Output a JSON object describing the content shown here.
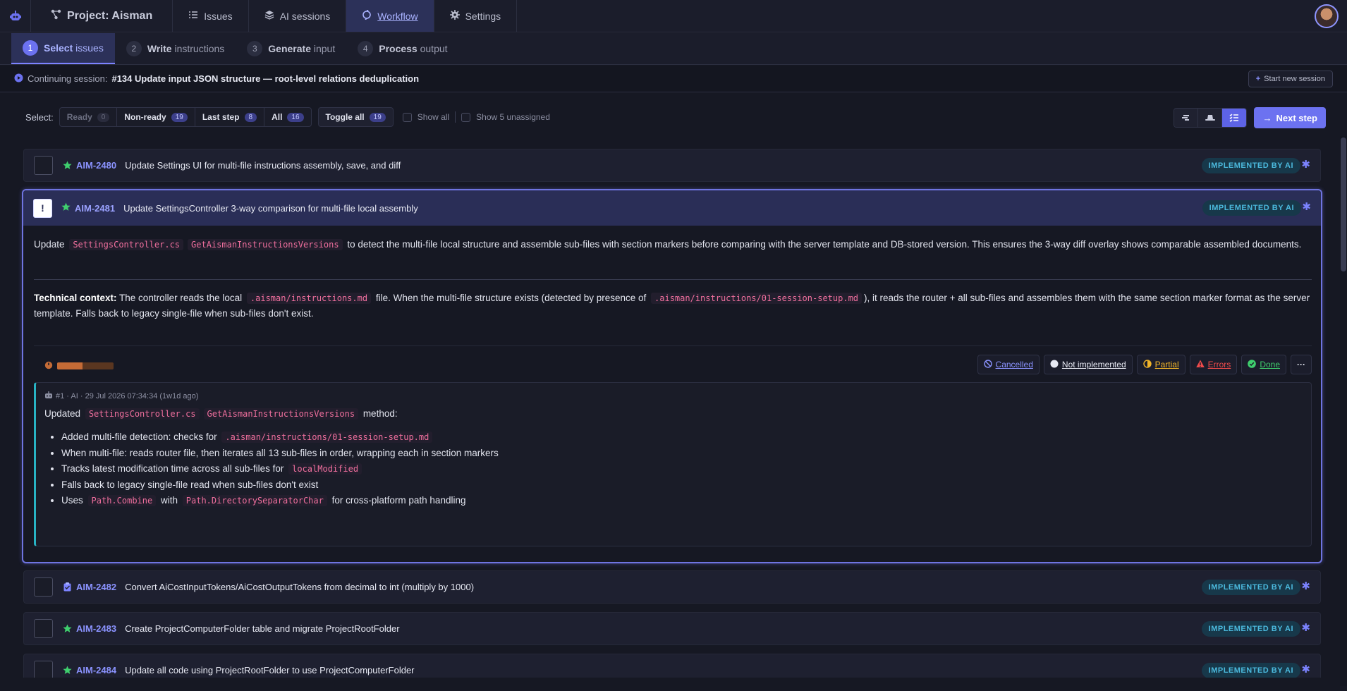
{
  "nav": {
    "project": "Project: Aisman",
    "items": [
      {
        "label": "Issues"
      },
      {
        "label": "AI sessions"
      },
      {
        "label": "Workflow"
      },
      {
        "label": "Settings"
      }
    ]
  },
  "steps": [
    {
      "num": "1",
      "bold": "Select",
      "rest": "issues"
    },
    {
      "num": "2",
      "bold": "Write",
      "rest": "instructions"
    },
    {
      "num": "3",
      "bold": "Generate",
      "rest": "input"
    },
    {
      "num": "4",
      "bold": "Process",
      "rest": "output"
    }
  ],
  "session": {
    "prefix": "Continuing session:",
    "title": "#134 Update input JSON structure — root-level relations deduplication",
    "new_button": "Start new session"
  },
  "filters": {
    "label": "Select:",
    "segments": [
      {
        "label": "Ready",
        "count": "0"
      },
      {
        "label": "Non-ready",
        "count": "19"
      },
      {
        "label": "Last step",
        "count": "8"
      },
      {
        "label": "All",
        "count": "16"
      }
    ],
    "toggle_all": {
      "label": "Toggle all",
      "count": "19"
    },
    "show_all": "Show all",
    "show_unassigned": "Show 5 unassigned",
    "next_step": "Next step"
  },
  "issues": [
    {
      "key": "AIM-2480",
      "title": "Update Settings UI for multi-file instructions assembly, save, and diff",
      "status": "IMPLEMENTED BY AI",
      "icon": "star-icon"
    },
    {
      "key": "AIM-2481",
      "title": "Update SettingsController 3-way comparison for multi-file local assembly",
      "status": "IMPLEMENTED BY AI",
      "icon": "star-icon"
    },
    {
      "key": "AIM-2482",
      "title": "Convert AiCostInputTokens/AiCostOutputTokens from decimal to int (multiply by 1000)",
      "status": "IMPLEMENTED BY AI",
      "icon": "clipboard-icon"
    },
    {
      "key": "AIM-2483",
      "title": "Create ProjectComputerFolder table and migrate ProjectRootFolder",
      "status": "IMPLEMENTED BY AI",
      "icon": "star-icon"
    },
    {
      "key": "AIM-2484",
      "title": "Update all code using ProjectRootFolder to use ProjectComputerFolder",
      "status": "IMPLEMENTED BY AI",
      "icon": "star-icon"
    }
  ],
  "expanded": {
    "checkbox_mark": "!",
    "desc_pre": "Update",
    "desc_code1": "SettingsController.cs",
    "desc_code2": "GetAismanInstructionsVersions",
    "desc_post": "to detect the multi-file local structure and assemble sub-files with section markers before comparing with the server template and DB-stored version. This ensures the 3-way diff overlay shows comparable assembled documents.",
    "tech_label": "Technical context:",
    "tech_pre": "The controller reads the local",
    "tech_code1": ".aisman/instructions.md",
    "tech_mid": "file. When the multi-file structure exists (detected by presence of",
    "tech_code2": ".aisman/instructions/01-session-setup.md",
    "tech_post": "), it reads the router + all sub-files and assembles them with the same section marker format as the server template. Falls back to legacy single-file when sub-files don't exist.",
    "progress": 0.45,
    "status_buttons": [
      {
        "label": "Cancelled",
        "color": "#8b93ff",
        "icon": "cancel-icon"
      },
      {
        "label": "Not implemented",
        "color": "#e7e9f3",
        "icon": "circle-icon"
      },
      {
        "label": "Partial",
        "color": "#f0b429",
        "icon": "half-circle-icon"
      },
      {
        "label": "Errors",
        "color": "#ef4b4b",
        "icon": "warning-icon"
      },
      {
        "label": "Done",
        "color": "#3fcf6e",
        "icon": "check-icon"
      }
    ],
    "comment": {
      "meta": "#1 · AI · 29 Jul 2026 07:34:34 (1w1d ago)",
      "body_pre": "Updated",
      "body_code1": "SettingsController.cs",
      "body_code2": "GetAismanInstructionsVersions",
      "body_post": "method:",
      "items": [
        {
          "pre": "Added multi-file detection: checks for",
          "code": ".aisman/instructions/01-session-setup.md",
          "mid": "",
          "code2": "",
          "post": ""
        },
        {
          "pre": "When multi-file: reads router file, then iterates all 13 sub-files in order, wrapping each in section markers",
          "code": "",
          "mid": "",
          "code2": "",
          "post": ""
        },
        {
          "pre": "Tracks latest modification time across all sub-files for",
          "code": "localModified",
          "mid": "",
          "code2": "",
          "post": ""
        },
        {
          "pre": "Falls back to legacy single-file read when sub-files don't exist",
          "code": "",
          "mid": "",
          "code2": "",
          "post": ""
        },
        {
          "pre": "Uses",
          "code": "Path.Combine",
          "mid": "with",
          "code2": "Path.DirectorySeparatorChar",
          "post": "for cross-platform path handling"
        }
      ]
    }
  },
  "colors": {
    "accent": "#6c72f0",
    "badge_text": "#4bb9dd",
    "star": "#3fcf6e"
  }
}
